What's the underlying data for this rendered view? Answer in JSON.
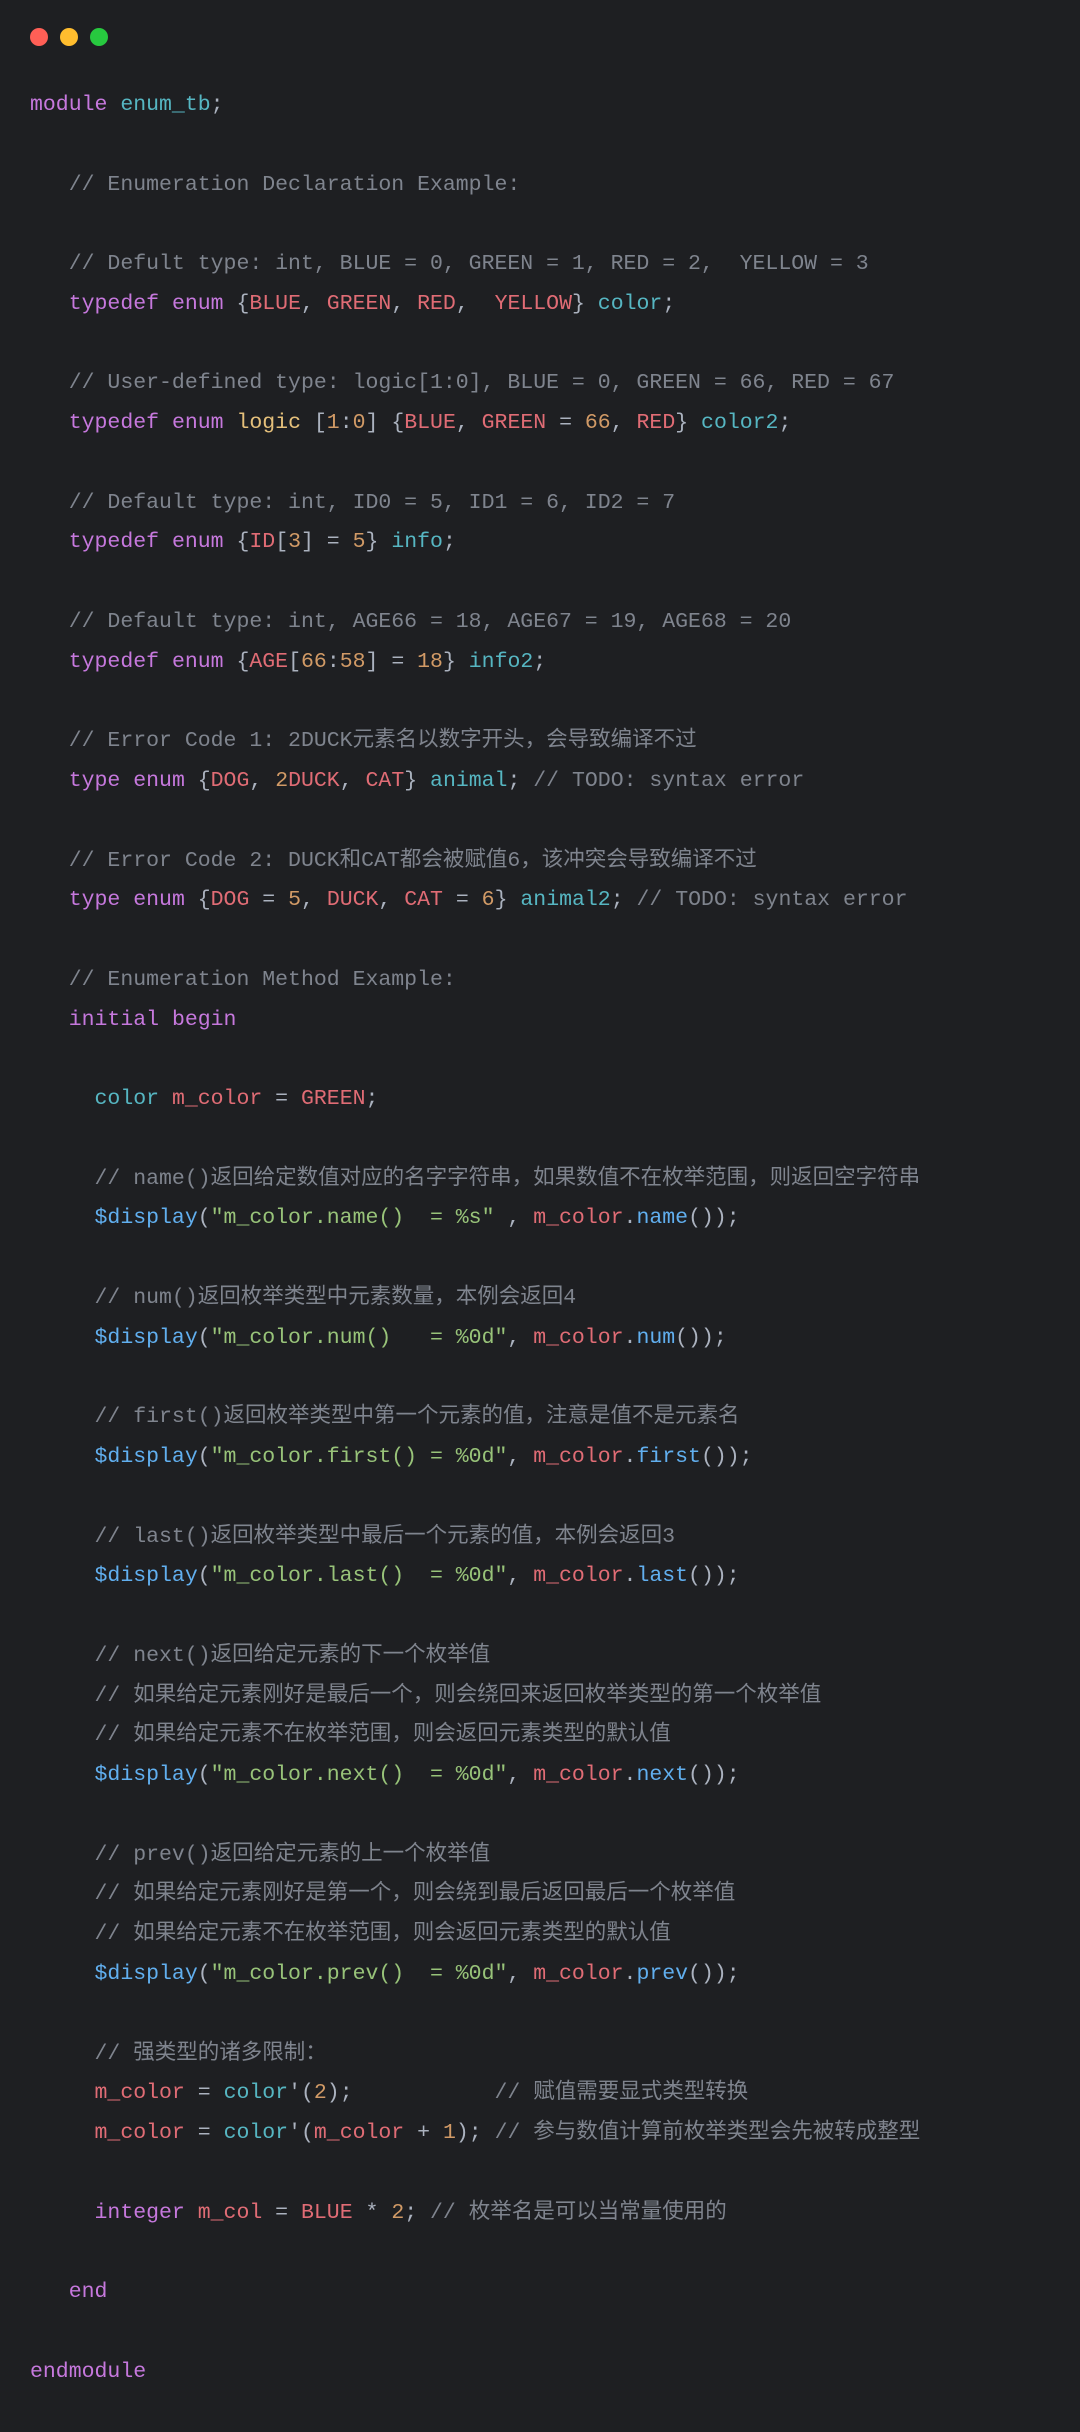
{
  "code": {
    "l1": {
      "kw1": "module",
      "id": "enum_tb",
      "p": ";"
    },
    "l3": {
      "c": "// Enumeration Declaration Example:"
    },
    "l5": {
      "c": "// Defult type: int, BLUE = 0, GREEN = 1, RED = 2,  YELLOW = 3"
    },
    "l6": {
      "kw1": "typedef",
      "kw2": "enum",
      "e1": "BLUE",
      "e2": "GREEN",
      "e3": "RED",
      "e4": "YELLOW",
      "id": "color"
    },
    "l8": {
      "c": "// User-defined type: logic[1:0], BLUE = 0, GREEN = 66, RED = 67"
    },
    "l9": {
      "kw1": "typedef",
      "kw2": "enum",
      "ty": "logic",
      "n1": "1",
      "n2": "0",
      "e1": "BLUE",
      "e2": "GREEN",
      "n3": "66",
      "e3": "RED",
      "id": "color2"
    },
    "l11": {
      "c": "// Default type: int, ID0 = 5, ID1 = 6, ID2 = 7"
    },
    "l12": {
      "kw1": "typedef",
      "kw2": "enum",
      "e1": "ID",
      "n1": "3",
      "n2": "5",
      "id": "info"
    },
    "l14": {
      "c": "// Default type: int, AGE66 = 18, AGE67 = 19, AGE68 = 20"
    },
    "l15": {
      "kw1": "typedef",
      "kw2": "enum",
      "e1": "AGE",
      "n1": "66",
      "n2": "58",
      "n3": "18",
      "id": "info2"
    },
    "l17": {
      "c": "// Error Code 1: 2DUCK元素名以数字开头，会导致编译不过"
    },
    "l18": {
      "kw1": "type",
      "kw2": "enum",
      "e1": "DOG",
      "n1": "2",
      "e2": "DUCK",
      "e3": "CAT",
      "id": "animal",
      "c": "// TODO: syntax error"
    },
    "l20": {
      "c": "// Error Code 2: DUCK和CAT都会被赋值6，该冲突会导致编译不过"
    },
    "l21": {
      "kw1": "type",
      "kw2": "enum",
      "e1": "DOG",
      "n1": "5",
      "e2": "DUCK",
      "e3": "CAT",
      "n2": "6",
      "id": "animal2",
      "c": "// TODO: syntax error"
    },
    "l23": {
      "c": "// Enumeration Method Example:"
    },
    "l24": {
      "kw1": "initial",
      "kw2": "begin"
    },
    "l26": {
      "ty": "color",
      "v": "m_color",
      "e": "GREEN"
    },
    "l28": {
      "c": "// name()返回给定数值对应的名字字符串，如果数值不在枚举范围，则返回空字符串"
    },
    "l29": {
      "fn": "$display",
      "s": "\"m_color.name()  = %s\"",
      "v": "m_color",
      "m": "name"
    },
    "l31": {
      "c": "// num()返回枚举类型中元素数量，本例会返回4"
    },
    "l32": {
      "fn": "$display",
      "s": "\"m_color.num()   = %0d\"",
      "v": "m_color",
      "m": "num"
    },
    "l34": {
      "c": "// first()返回枚举类型中第一个元素的值，注意是值不是元素名"
    },
    "l35": {
      "fn": "$display",
      "s": "\"m_color.first() = %0d\"",
      "v": "m_color",
      "m": "first"
    },
    "l37": {
      "c": "// last()返回枚举类型中最后一个元素的值，本例会返回3"
    },
    "l38": {
      "fn": "$display",
      "s": "\"m_color.last()  = %0d\"",
      "v": "m_color",
      "m": "last"
    },
    "l40": {
      "c": "// next()返回给定元素的下一个枚举值"
    },
    "l41": {
      "c": "// 如果给定元素刚好是最后一个，则会绕回来返回枚举类型的第一个枚举值"
    },
    "l42": {
      "c": "// 如果给定元素不在枚举范围，则会返回元素类型的默认值"
    },
    "l43": {
      "fn": "$display",
      "s": "\"m_color.next()  = %0d\"",
      "v": "m_color",
      "m": "next"
    },
    "l45": {
      "c": "// prev()返回给定元素的上一个枚举值"
    },
    "l46": {
      "c": "// 如果给定元素刚好是第一个，则会绕到最后返回最后一个枚举值"
    },
    "l47": {
      "c": "// 如果给定元素不在枚举范围，则会返回元素类型的默认值"
    },
    "l48": {
      "fn": "$display",
      "s": "\"m_color.prev()  = %0d\"",
      "v": "m_color",
      "m": "prev"
    },
    "l50": {
      "c": "// 强类型的诸多限制："
    },
    "l51": {
      "v": "m_color",
      "ty": "color",
      "n": "2",
      "c": "// 赋值需要显式类型转换"
    },
    "l52": {
      "v": "m_color",
      "ty": "color",
      "v2": "m_color",
      "n": "1",
      "c": "// 参与数值计算前枚举类型会先被转成整型"
    },
    "l54": {
      "kw": "integer",
      "v": "m_col",
      "e": "BLUE",
      "n": "2",
      "c": "// 枚举名是可以当常量使用的"
    },
    "l56": {
      "kw": "end"
    },
    "l58": {
      "kw": "endmodule"
    }
  }
}
